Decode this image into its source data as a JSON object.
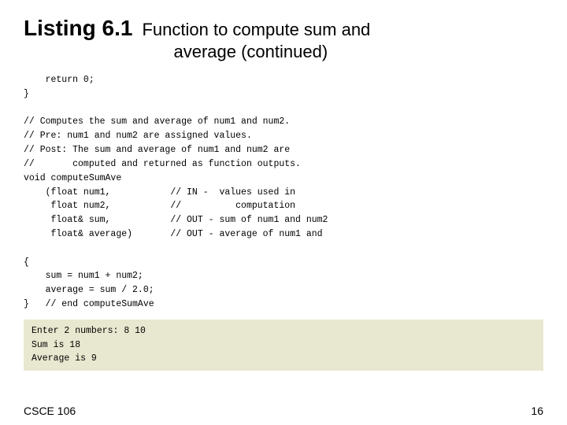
{
  "title": {
    "listing_label": "Listing 6.1",
    "description_line1": "Function to compute sum and",
    "description_line2": "average (continued)"
  },
  "code": {
    "main_code": "    return 0;\n}\n\n// Computes the sum and average of num1 and num2.\n// Pre: num1 and num2 are assigned values.\n// Post: The sum and average of num1 and num2 are\n//       computed and returned as function outputs.\nvoid computeSumAve\n    (float num1,           // IN -  values used in\n     float num2,           //          computation\n     float& sum,           // OUT - sum of num1 and num2\n     float& average)       // OUT - average of num1 and\n\n{\n    sum = num1 + num2;\n    average = sum / 2.0;\n}   // end computeSumAve",
    "output": "Enter 2 numbers: 8 10\nSum is 18\nAverage is 9"
  },
  "footer": {
    "left": "CSCE 106",
    "right": "16"
  }
}
